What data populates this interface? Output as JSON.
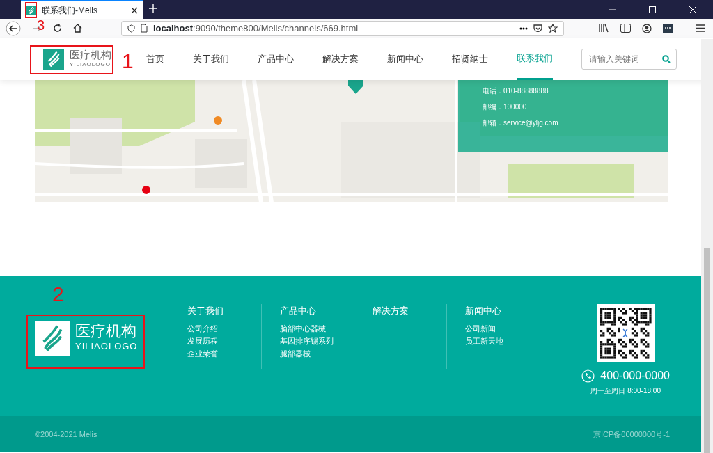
{
  "browser": {
    "tab_title": "联系我们-Melis",
    "url_host": "localhost",
    "url_rest": ":9090/theme800/Melis/channels/669.html"
  },
  "header": {
    "logo": {
      "name": "医疗机构",
      "sub": "YILIAOLOGO"
    },
    "nav": [
      {
        "label": "首页",
        "selected": false
      },
      {
        "label": "关于我们",
        "selected": false
      },
      {
        "label": "产品中心",
        "selected": false
      },
      {
        "label": "解决方案",
        "selected": false
      },
      {
        "label": "新闻中心",
        "selected": false
      },
      {
        "label": "招贤纳士",
        "selected": false
      },
      {
        "label": "联系我们",
        "selected": true
      }
    ],
    "search": {
      "placeholder": "请输入关键词"
    }
  },
  "contact_card": {
    "lines": [
      "电话：010-88888888",
      "邮编：100000",
      "邮箱：service@yljg.com"
    ]
  },
  "footer": {
    "logo": {
      "name": "医疗机构",
      "sub": "YILIAOLOGO"
    },
    "columns": [
      {
        "title": "关于我们",
        "links": [
          "公司介绍",
          "发展历程",
          "企业荣誉"
        ]
      },
      {
        "title": "产品中心",
        "links": [
          "脑部中心器械",
          "基因排序锡系列",
          "腿部器械"
        ]
      },
      {
        "title": "解决方案"
      },
      {
        "title": "新闻中心",
        "links": [
          "公司新闻",
          "员工新天地"
        ]
      }
    ],
    "phone": "400-000-0000",
    "hours": "周一至周日 8:00-18:00",
    "copyright": "©2004-2021 Melis",
    "icp": "京ICP备00000000号-1"
  },
  "annotations": [
    {
      "label": "1"
    },
    {
      "label": "2"
    },
    {
      "label": "3"
    }
  ]
}
